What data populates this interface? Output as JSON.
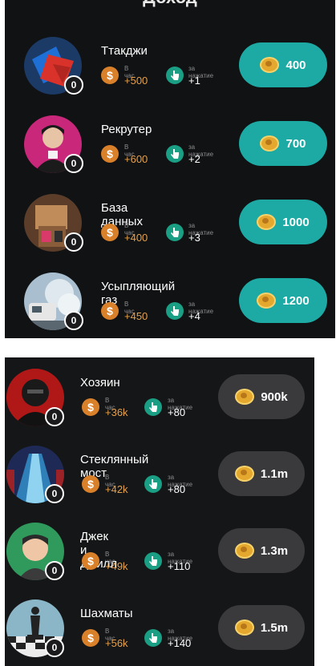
{
  "screen_title": "Доход",
  "labels": {
    "per_hour": "В час",
    "per_tap": "за нажатие"
  },
  "colors": {
    "buy_active": "#1daaa4",
    "buy_locked": "#3a3a3d",
    "hour_value": "#e6a04a",
    "coin_icon": "#d9802a",
    "tap_icon": "#1a9e84"
  },
  "icons": {
    "coin": "dollar-coin-icon",
    "tap": "pointer-finger-icon",
    "cost": "gold-coin-icon"
  },
  "panel1": {
    "items": [
      {
        "name": "Ттакджи",
        "level": "0",
        "per_hour": "+500",
        "per_tap": "+1",
        "cost": "400"
      },
      {
        "name": "Рекрутер",
        "level": "0",
        "per_hour": "+600",
        "per_tap": "+2",
        "cost": "700"
      },
      {
        "name": "База данных",
        "level": "0",
        "per_hour": "+400",
        "per_tap": "+3",
        "cost": "1000"
      },
      {
        "name": "Усыпляющий газ",
        "level": "0",
        "per_hour": "+450",
        "per_tap": "+4",
        "cost": "1200"
      }
    ]
  },
  "panel2": {
    "items": [
      {
        "name": "Хозяин",
        "level": "0",
        "per_hour": "+36k",
        "per_tap": "+80",
        "cost": "900k"
      },
      {
        "name": "Стеклянный мост",
        "level": "0",
        "per_hour": "+42k",
        "per_tap": "+80",
        "cost": "1.1m"
      },
      {
        "name": "Джек и Джилл",
        "level": "0",
        "per_hour": "+49k",
        "per_tap": "+110",
        "cost": "1.3m"
      },
      {
        "name": "Шахматы",
        "level": "0",
        "per_hour": "+56k",
        "per_tap": "+140",
        "cost": "1.5m"
      }
    ]
  }
}
